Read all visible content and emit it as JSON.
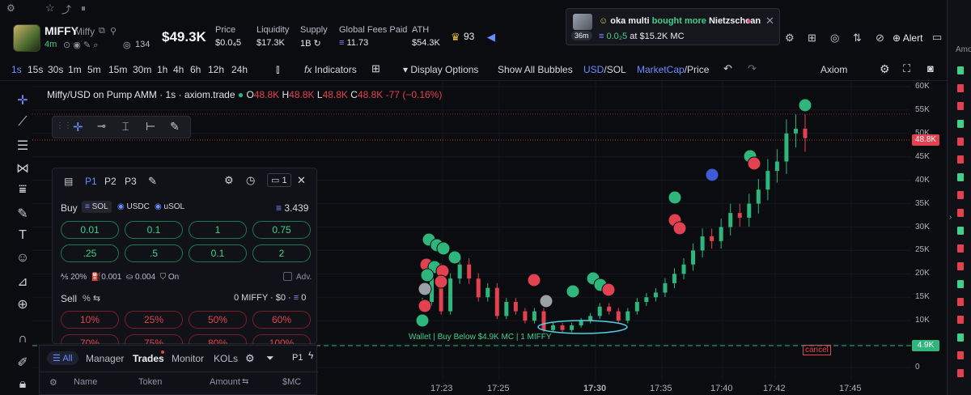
{
  "topbar": {
    "icons": [
      "settings-icon",
      "star-icon",
      "chart-icon",
      "pause-icon"
    ]
  },
  "token": {
    "name": "MIFFY",
    "ticker": "Miffy",
    "age": "4m",
    "holders": "134",
    "market_cap": "$49.3K",
    "stats": [
      {
        "label": "Price",
        "value": "$0.0₄5"
      },
      {
        "label": "Liquidity",
        "value": "$17.3K"
      },
      {
        "label": "Supply",
        "value": "1B"
      },
      {
        "label": "Global Fees Paid",
        "value": "11.73"
      },
      {
        "label": "ATH",
        "value": "$54.3K"
      }
    ],
    "crown_count": "93",
    "alert_label": "Alert"
  },
  "notification": {
    "user": "oka multi",
    "action": "bought more",
    "target": "Nietzschean",
    "age": "36m",
    "amount": "0.0₂5",
    "at_label": "at",
    "mc": "$15.2K",
    "mc_suffix": "MC"
  },
  "toolbar": {
    "intervals": [
      "1s",
      "15s",
      "30s",
      "1m",
      "5m",
      "15m",
      "30m",
      "1h",
      "4h",
      "6h",
      "12h",
      "24h"
    ],
    "active_interval": "1s",
    "indicators_label": "Indicators",
    "display_options_label": "Display Options",
    "show_bubbles_label": "Show All Bubbles",
    "currency_a": "USD",
    "currency_sep": "/",
    "currency_b": "SOL",
    "mode_a": "MarketCap",
    "mode_sep": "/",
    "mode_b": "Price",
    "platform": "Axiom"
  },
  "chart": {
    "legend_title": "Miffy/USD on Pump AMM · 1s · axiom.trade",
    "ohlc": {
      "o_label": "O",
      "o": "48.8K",
      "h_label": "H",
      "h": "48.8K",
      "l_label": "L",
      "l": "48.8K",
      "c_label": "C",
      "c": "48.8K",
      "change": "-77 (−0.16%)"
    },
    "y_ticks": [
      "60K",
      "55K",
      "50K",
      "45K",
      "40K",
      "35K",
      "30K",
      "25K",
      "20K",
      "15K",
      "10K",
      "5K",
      "0"
    ],
    "x_ticks": [
      "17:23",
      "17:25",
      "17:30",
      "17:35",
      "17:40",
      "17:42",
      "17:45"
    ],
    "current_price_tag": "48.8K",
    "limit_price_tag": "4.9K",
    "limit_label": "Wallet | Buy Below $4.9K MC | 1 MIFFY",
    "cancel_label": "cancel",
    "accent_up": "#2fb67c",
    "accent_down": "#e2424f"
  },
  "chart_data": {
    "type": "line",
    "title": "Miffy/USD on Pump AMM · 1s · axiom.trade",
    "ylim": [
      0,
      60000
    ],
    "y_unit": "USD market cap",
    "x": [
      "17:22:30",
      "17:23",
      "17:23:30",
      "17:24",
      "17:24:30",
      "17:25",
      "17:25:30",
      "17:26",
      "17:26:30",
      "17:27",
      "17:27:30",
      "17:28",
      "17:28:30",
      "17:29",
      "17:29:30",
      "17:30",
      "17:30:30",
      "17:31",
      "17:31:30",
      "17:32",
      "17:32:30",
      "17:33",
      "17:33:30",
      "17:34",
      "17:34:30",
      "17:35",
      "17:35:30",
      "17:36",
      "17:36:30",
      "17:37",
      "17:37:30",
      "17:38",
      "17:38:30",
      "17:39",
      "17:39:30",
      "17:40",
      "17:40:30",
      "17:41",
      "17:41:30",
      "17:42",
      "17:42:30",
      "17:43"
    ],
    "series": [
      {
        "values": [
          14000,
          21000,
          12000,
          19000,
          22000,
          19000,
          15000,
          17000,
          11000,
          14000,
          12000,
          10000,
          12000,
          8000,
          9000,
          8000,
          9000,
          10000,
          11000,
          13000,
          12000,
          10000,
          12000,
          14000,
          15000,
          16000,
          18000,
          20000,
          22000,
          25000,
          28000,
          27000,
          30000,
          33000,
          32000,
          35000,
          38000,
          42000,
          44000,
          50000,
          51000,
          49000
        ]
      }
    ],
    "grid": true
  },
  "drawtools": {
    "icons": [
      "crosshair-icon",
      "horizontal-line-icon",
      "vertical-line-icon",
      "range-icon",
      "brush-icon"
    ]
  },
  "panel": {
    "tabs": [
      "P1",
      "P2",
      "P3"
    ],
    "wallet_count": "1",
    "buy_label": "Buy",
    "buy_currencies": [
      "SOL",
      "USDC",
      "uSOL"
    ],
    "sol_balance": "3.439",
    "buy_amounts": [
      "0.01",
      "0.1",
      "1",
      "0.75",
      ".25",
      ".5",
      "0.1",
      "2"
    ],
    "buy_settings": {
      "slippage": "20%",
      "priority": "0.001",
      "bribe": "0.004",
      "mev": "On",
      "adv": "Adv."
    },
    "sell_label": "Sell",
    "sell_pct_label": "%",
    "sell_balance": "0 MIFFY · $0 ·",
    "sell_sol": "0",
    "sell_amounts": [
      "10%",
      "25%",
      "50%",
      "60%",
      "70%",
      "75%",
      "80%",
      "100%"
    ]
  },
  "bottom": {
    "tabs": [
      "All",
      "Manager",
      "Trades",
      "Monitor",
      "KOLs"
    ],
    "active_tab": "Trades",
    "preset": "P1",
    "columns": [
      "Name",
      "Token",
      "Amount",
      "$MC"
    ]
  },
  "rightstrip": {
    "header": "Amo"
  }
}
